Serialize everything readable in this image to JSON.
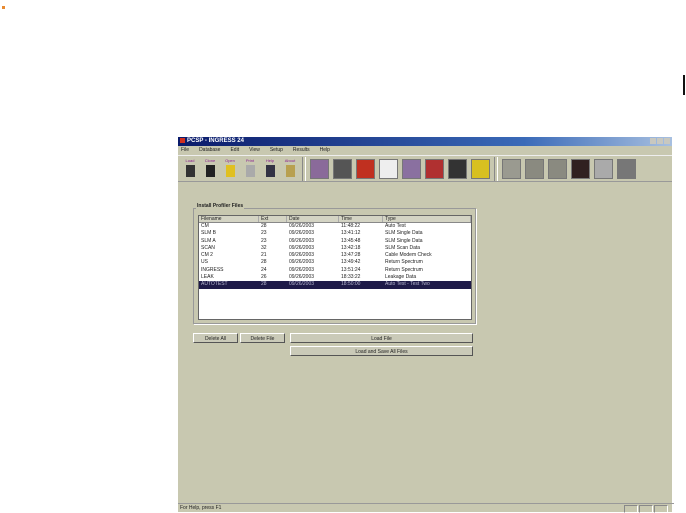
{
  "window": {
    "title": "PCSP - INGRESS 24"
  },
  "menu": [
    "File",
    "Database",
    "Edit",
    "View",
    "Setup",
    "Results",
    "Help"
  ],
  "toolbar": {
    "buttons": [
      {
        "label": "Load",
        "color": "#333"
      },
      {
        "label": "Clone",
        "color": "#222"
      },
      {
        "label": "Open",
        "color": "#e0c020"
      },
      {
        "label": "Print",
        "color": "#aaa"
      },
      {
        "label": "Help",
        "color": "#334"
      },
      {
        "label": "About",
        "color": "#b8a050"
      }
    ],
    "icons": [
      "meter-setup-icon",
      "cable-icon",
      "traffic-light-icon",
      "chart-icon",
      "spectrum-icon",
      "battery-icon",
      "probe-icon",
      "eye-icon",
      "bars-icon-1",
      "bars-icon-2",
      "bars-icon-3",
      "bars-icon-4",
      "printer-icon-1",
      "printer-icon-2"
    ]
  },
  "group": {
    "label": "Install Profiler Files"
  },
  "table": {
    "headers": [
      "Filename",
      "Ext",
      "Date",
      "Time",
      "Type"
    ],
    "rows": [
      [
        "CM",
        "28",
        "09/26/2003",
        "11:48:22",
        "Auto Test"
      ],
      [
        "SLM B",
        "23",
        "09/26/2003",
        "13:41:12",
        "SLM Single Data"
      ],
      [
        "SLM A",
        "23",
        "09/26/2003",
        "13:45:48",
        "SLM Single Data"
      ],
      [
        "SCAN",
        "32",
        "09/26/2003",
        "13:42:18",
        "SLM Scan Data"
      ],
      [
        "CM 2",
        "21",
        "09/26/2003",
        "13:47:28",
        "Cable Modem Check"
      ],
      [
        "US",
        "28",
        "09/26/2003",
        "13:49:42",
        "Return Spectrum"
      ],
      [
        "INGRESS",
        "24",
        "09/26/2003",
        "13:51:24",
        "Return Spectrum"
      ],
      [
        "LEAK",
        "26",
        "09/26/2003",
        "18:33:22",
        "Leakage Data"
      ],
      [
        "AUTOTEST",
        "28",
        "09/26/2003",
        "18:50:00",
        "Auto Test - Test Two"
      ]
    ],
    "selected_index": 8
  },
  "buttons": {
    "delete_all": "Delete All",
    "delete_file": "Delete File",
    "load_file": "Load File",
    "load_save_all": "Load and Save All Files"
  },
  "status": {
    "text": "For Help, press F1"
  }
}
